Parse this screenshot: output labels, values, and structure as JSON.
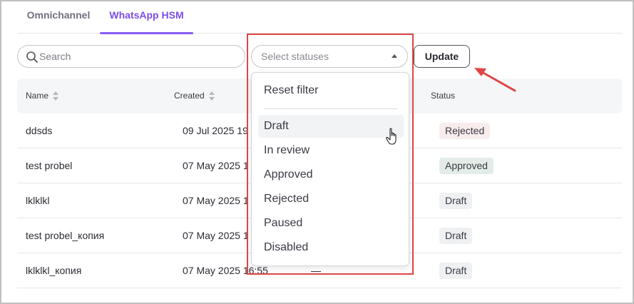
{
  "tabs": [
    {
      "label": "Omnichannel",
      "active": false
    },
    {
      "label": "WhatsApp HSM",
      "active": true
    }
  ],
  "toolbar": {
    "search_placeholder": "Search",
    "status_select_placeholder": "Select statuses",
    "update_label": "Update"
  },
  "table": {
    "columns": [
      "Name",
      "Created",
      "Status"
    ],
    "rows": [
      {
        "name": "ddsds",
        "created": "09 Jul 2025 19",
        "extra": "",
        "status": "Rejected"
      },
      {
        "name": "test probel",
        "created": "07 May 2025 1",
        "extra": "",
        "status": "Approved"
      },
      {
        "name": "lklklkl",
        "created": "07 May 2025 1",
        "extra": "",
        "status": "Draft"
      },
      {
        "name": "test probel_копия",
        "created": "07 May 2025 1",
        "extra": "",
        "status": "Draft"
      },
      {
        "name": "lklklkl_копия",
        "created": "07 May 2025 16:55",
        "extra": "—",
        "status": "Draft"
      }
    ]
  },
  "dropdown": {
    "reset_label": "Reset filter",
    "options": [
      "Draft",
      "In review",
      "Approved",
      "Rejected",
      "Paused",
      "Disabled"
    ],
    "hovered": "Draft"
  },
  "colors": {
    "accent": "#7a4ee8",
    "highlight": "#e04545",
    "rejected_bg": "#f8ecec",
    "approved_bg": "#e3ece7",
    "draft_bg": "#eef0f2"
  }
}
